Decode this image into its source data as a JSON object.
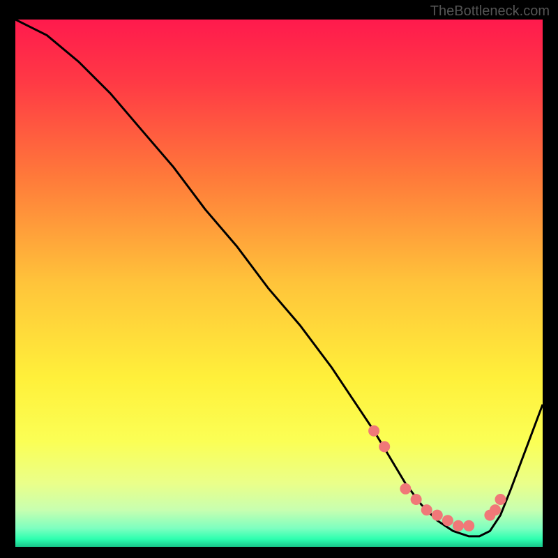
{
  "watermark": "TheBottleneck.com",
  "chart_data": {
    "type": "line",
    "title": "",
    "xlabel": "",
    "ylabel": "",
    "x_range": [
      0,
      100
    ],
    "y_range": [
      0,
      100
    ],
    "curve": {
      "x": [
        0,
        6,
        12,
        18,
        24,
        30,
        36,
        42,
        48,
        54,
        60,
        64,
        68,
        71,
        74,
        77,
        80,
        83,
        86,
        88,
        90,
        92,
        94,
        100
      ],
      "y": [
        100,
        97,
        92,
        86,
        79,
        72,
        64,
        57,
        49,
        42,
        34,
        28,
        22,
        17,
        12,
        8,
        5,
        3,
        2,
        2,
        3,
        6,
        11,
        27
      ]
    },
    "markers": {
      "x": [
        68,
        70,
        74,
        76,
        78,
        80,
        82,
        84,
        86,
        90,
        91,
        92
      ],
      "y": [
        22,
        19,
        11,
        9,
        7,
        6,
        5,
        4,
        4,
        6,
        7,
        9
      ]
    },
    "gradient_stops": [
      {
        "offset": 0.0,
        "color": "#ff1a4d"
      },
      {
        "offset": 0.12,
        "color": "#ff3a45"
      },
      {
        "offset": 0.3,
        "color": "#ff7a3a"
      },
      {
        "offset": 0.5,
        "color": "#ffc43a"
      },
      {
        "offset": 0.68,
        "color": "#fff03a"
      },
      {
        "offset": 0.8,
        "color": "#fbff55"
      },
      {
        "offset": 0.88,
        "color": "#eaff8a"
      },
      {
        "offset": 0.93,
        "color": "#c8ffb0"
      },
      {
        "offset": 0.965,
        "color": "#7dffc0"
      },
      {
        "offset": 0.985,
        "color": "#2effb0"
      },
      {
        "offset": 1.0,
        "color": "#18c78a"
      }
    ],
    "marker_color": "#f07878",
    "curve_color": "#000000"
  }
}
